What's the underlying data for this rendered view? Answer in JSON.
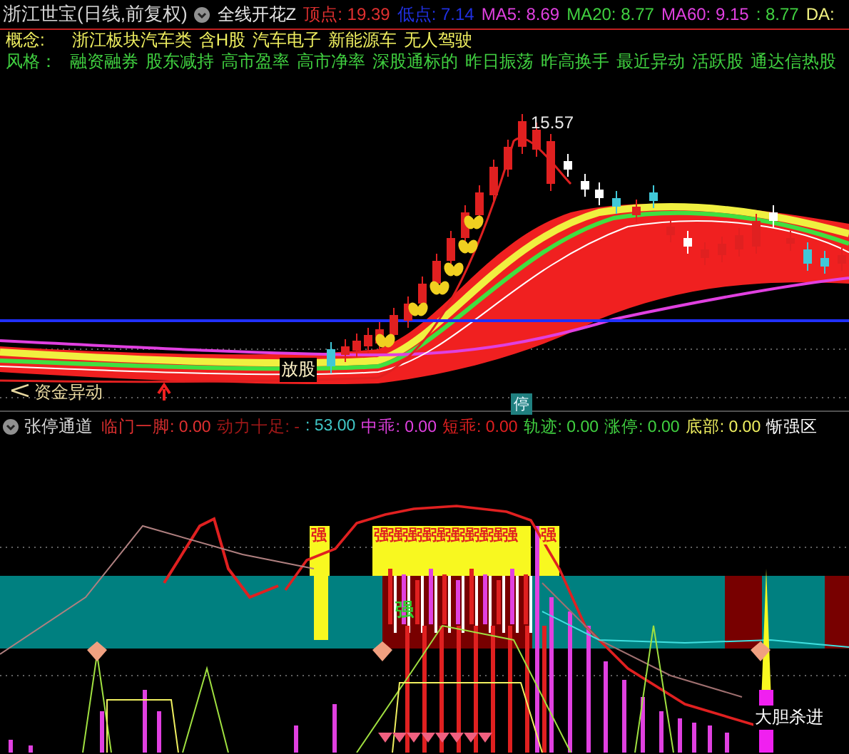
{
  "header": {
    "title": "浙江世宝(日线,前复权)",
    "formula": "全线开花Z",
    "readings": [
      {
        "text": "顶点: 19.39",
        "color": "#e03030"
      },
      {
        "text": "低点: 7.14",
        "color": "#2030e0"
      },
      {
        "text": "MA5: 8.69",
        "color": "#e040e0"
      },
      {
        "text": "MA20: 8.77",
        "color": "#40d040"
      },
      {
        "text": "MA60: 9.15",
        "color": "#e040e0"
      },
      {
        "text": ": 8.77",
        "color": "#40d040"
      },
      {
        "text": "DA:",
        "color": "#f0f080"
      }
    ]
  },
  "concepts": {
    "label": "概念:",
    "tags": [
      "浙江板块汽车类",
      "含H股",
      "汽车电子",
      "新能源车",
      "无人驾驶"
    ]
  },
  "styles": {
    "label": "风格：",
    "tags": [
      "融资融券",
      "股东减持",
      "高市盈率",
      "高市净率",
      "深股通标的",
      "昨日振荡",
      "昨高换手",
      "最近异动",
      "活跃股",
      "通达信热股"
    ]
  },
  "main_chart": {
    "peak_price": "15.57",
    "signal_note": "资金异动",
    "pattern_note": "放股",
    "limit_badge": "停"
  },
  "indicator": {
    "name": "张停通道",
    "readings": [
      {
        "text": "临门一脚: 0.00",
        "color": "#e03030"
      },
      {
        "text": "动力十足: -",
        "color": "#a01818"
      },
      {
        "text": ": 53.00",
        "color": "#40c8c8"
      },
      {
        "text": "中乖: 0.00",
        "color": "#e040e0"
      },
      {
        "text": "短乖: 0.00",
        "color": "#e02020"
      },
      {
        "text": "轨迹: 0.00",
        "color": "#40d040"
      },
      {
        "text": "涨停: 0.00",
        "color": "#40d040"
      },
      {
        "text": "底部: 0.00",
        "color": "#f0f060"
      },
      {
        "text": "惭强区",
        "color": "#ffffff"
      }
    ],
    "strong_marks": [
      {
        "text": "强",
        "color": "#e02020"
      },
      {
        "text": "强",
        "color": "#e02020"
      },
      {
        "text": "强",
        "color": "#e02020"
      },
      {
        "text": "强",
        "color": "#e02020"
      },
      {
        "text": "强",
        "color": "#e02020"
      },
      {
        "text": "强",
        "color": "#e02020"
      },
      {
        "text": "强",
        "color": "#e02020"
      },
      {
        "text": "强",
        "color": "#e02020"
      },
      {
        "text": "强",
        "color": "#e02020"
      },
      {
        "text": "强",
        "color": "#e02020"
      },
      {
        "text": "强",
        "color": "#e02020"
      },
      {
        "text": "强",
        "color": "#e02020"
      },
      {
        "text": "强",
        "color": "#30d030"
      }
    ],
    "note": "大胆杀进"
  }
}
